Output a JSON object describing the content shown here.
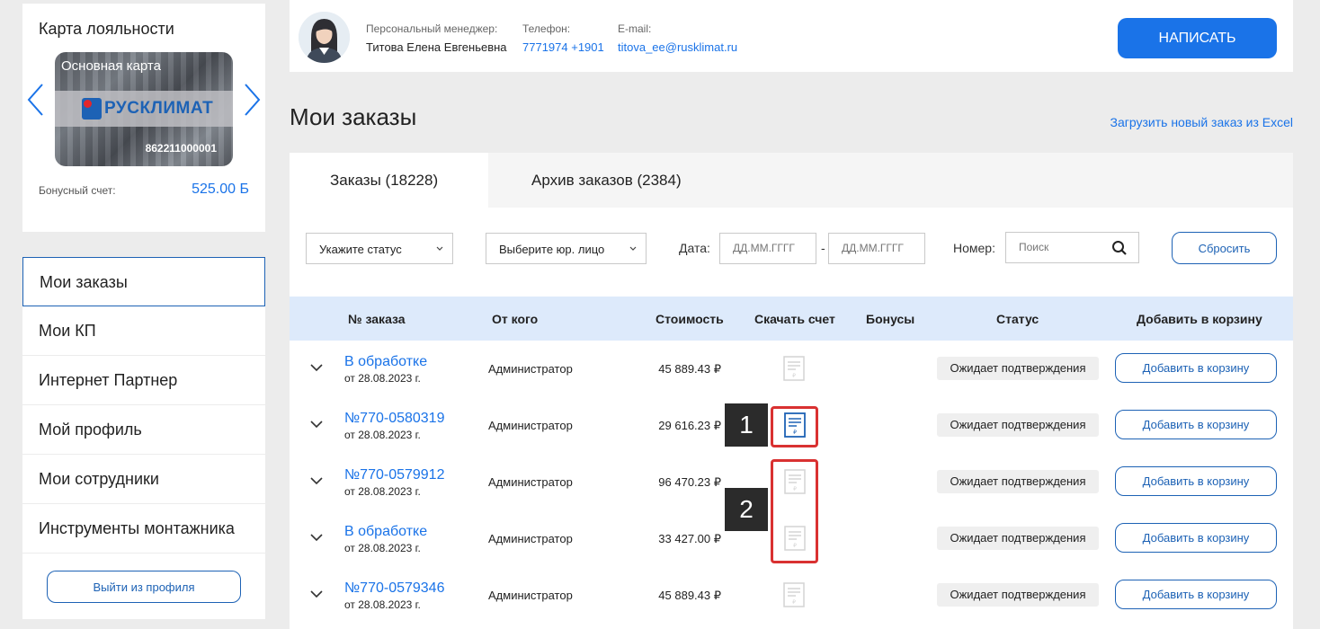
{
  "loyalty": {
    "title": "Карта лояльности",
    "card_name": "Основная карта",
    "card_brand": "РУСКЛИМАТ",
    "card_number": "862211000001",
    "bonus_label": "Бонусный счет:",
    "bonus_value": "525.00 Б"
  },
  "menu": {
    "items": [
      {
        "label": "Мои заказы"
      },
      {
        "label": "Мои КП"
      },
      {
        "label": "Интернет Партнер"
      },
      {
        "label": "Мой профиль"
      },
      {
        "label": "Мои сотрудники"
      },
      {
        "label": "Инструменты монтажника"
      }
    ],
    "logout_label": "Выйти из профиля"
  },
  "manager": {
    "label": "Персональный менеджер:",
    "name": "Титова Елена Евгеньевна",
    "phone_label": "Телефон:",
    "phone": "7771974 +1901",
    "email_label": "E-mail:",
    "email": "titova_ee@rusklimat.ru",
    "write_label": "НАПИСАТЬ"
  },
  "page": {
    "title": "Мои заказы",
    "excel_link": "Загрузить новый заказ из Excel"
  },
  "tabs": {
    "orders": "Заказы (18228)",
    "archive": "Архив заказов (2384)"
  },
  "filters": {
    "status_placeholder": "Укажите статус",
    "legal_placeholder": "Выберите юр. лицо",
    "date_label": "Дата:",
    "date_from_placeholder": "ДД.ММ.ГГГГ",
    "date_sep": "-",
    "date_to_placeholder": "ДД.ММ.ГГГГ",
    "number_label": "Номер:",
    "search_placeholder": "Поиск",
    "reset_label": "Сбросить"
  },
  "table": {
    "headers": {
      "number": "№ заказа",
      "from": "От кого",
      "cost": "Стоимость",
      "invoice": "Скачать счет",
      "bonus": "Бонусы",
      "status": "Статус",
      "cart": "Добавить в корзину"
    },
    "rows": [
      {
        "order": "В обработке",
        "date": "от 28.08.2023 г.",
        "from": "Администратор",
        "cost": "45 889.43 ₽",
        "status": "Ожидает подтверждения",
        "add": "Добавить в корзину"
      },
      {
        "order": "№770-0580319",
        "date": "от 28.08.2023 г.",
        "from": "Администратор",
        "cost": "29 616.23 ₽",
        "status": "Ожидает подтверждения",
        "add": "Добавить в корзину"
      },
      {
        "order": "№770-0579912",
        "date": "от 28.08.2023 г.",
        "from": "Администратор",
        "cost": "96 470.23 ₽",
        "status": "Ожидает подтверждения",
        "add": "Добавить в корзину"
      },
      {
        "order": "В обработке",
        "date": "от 28.08.2023 г.",
        "from": "Администратор",
        "cost": "33 427.00 ₽",
        "status": "Ожидает подтверждения",
        "add": "Добавить в корзину"
      },
      {
        "order": "№770-0579346",
        "date": "от 28.08.2023 г.",
        "from": "Администратор",
        "cost": "45 889.43 ₽",
        "status": "Ожидает подтверждения",
        "add": "Добавить в корзину"
      }
    ]
  },
  "annotations": {
    "marker1": "1",
    "marker2": "2"
  },
  "colors": {
    "accent": "#1a73e8",
    "brand_blue": "#1d62b5",
    "highlight_red": "#d93131"
  }
}
